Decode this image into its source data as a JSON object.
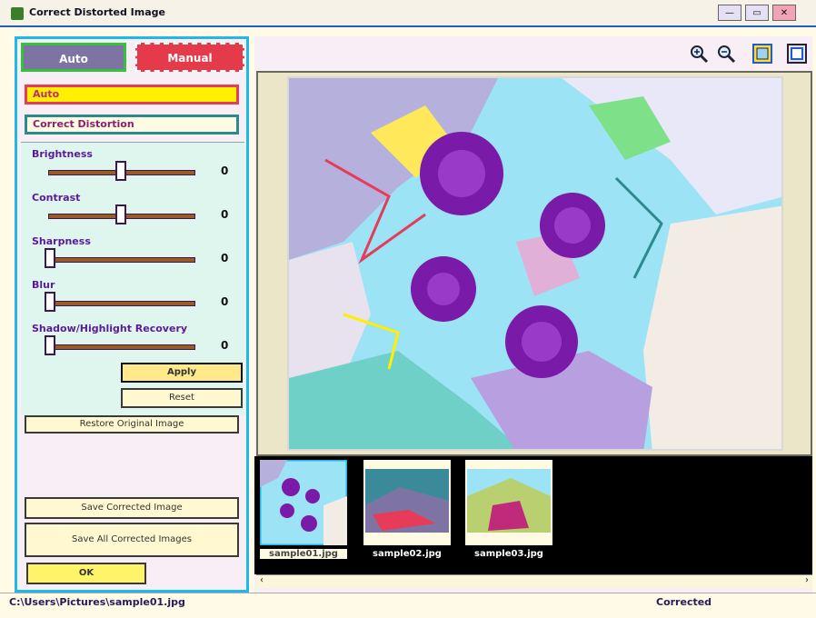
{
  "window": {
    "title": "Correct Distorted Image",
    "minimize_label": "—",
    "maximize_label": "▭",
    "close_label": "✕"
  },
  "tabs": [
    {
      "label": "Auto"
    },
    {
      "label": "Manual"
    }
  ],
  "manual": {
    "preset_value": "Auto",
    "mode_value": "Correct Distortion",
    "sliders": [
      {
        "label": "Brightness",
        "value": "0",
        "position": 0.5
      },
      {
        "label": "Contrast",
        "value": "0",
        "position": 0.5
      },
      {
        "label": "Sharpness",
        "value": "0",
        "position": 0.0
      },
      {
        "label": "Blur",
        "value": "0",
        "position": 0.0
      },
      {
        "label": "Shadow/Highlight Recovery",
        "value": "0",
        "position": 0.0
      }
    ],
    "apply_label": "Apply",
    "reset_label": "Reset",
    "restore_label": "Restore Original Image",
    "save_image_label": "Save Corrected Image",
    "save_all_label": "Save All Corrected Images",
    "ok_label": "OK"
  },
  "toolbar": {
    "icons": [
      "zoom-in-icon",
      "zoom-out-icon",
      "fit-window-icon",
      "actual-size-icon"
    ]
  },
  "thumbnails": [
    {
      "caption": "sample01.jpg",
      "selected": true
    },
    {
      "caption": "sample02.jpg",
      "selected": false
    },
    {
      "caption": "sample03.jpg",
      "selected": false
    }
  ],
  "status": {
    "left_text": "C:\\Users\\Pictures\\sample01.jpg",
    "right_text": "Corrected"
  }
}
